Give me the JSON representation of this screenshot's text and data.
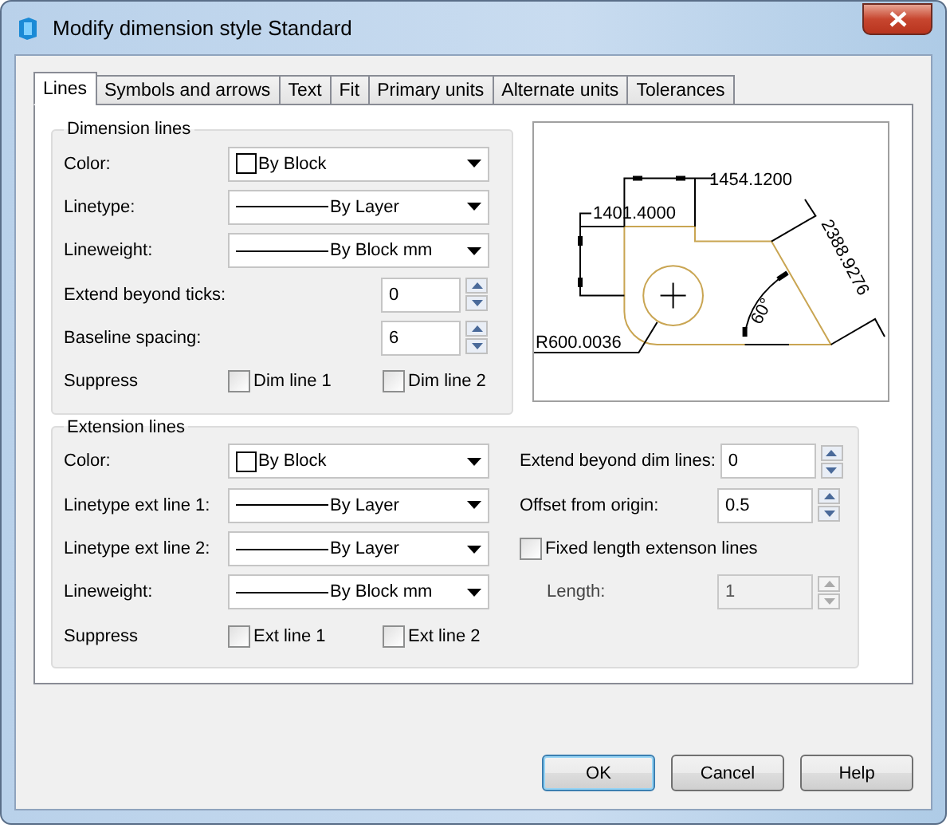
{
  "window": {
    "title": "Modify dimension style Standard"
  },
  "tabs": [
    {
      "label": "Lines",
      "selected": true
    },
    {
      "label": "Symbols and arrows",
      "selected": false
    },
    {
      "label": "Text",
      "selected": false
    },
    {
      "label": "Fit",
      "selected": false
    },
    {
      "label": "Primary units",
      "selected": false
    },
    {
      "label": "Alternate units",
      "selected": false
    },
    {
      "label": "Tolerances",
      "selected": false
    }
  ],
  "dimension_lines": {
    "title": "Dimension lines",
    "rows": [
      {
        "kind": "color",
        "label": "Color:",
        "value": "By Block"
      },
      {
        "kind": "linetype",
        "label": "Linetype:",
        "value": "By Layer"
      },
      {
        "kind": "linetype",
        "label": "Lineweight:",
        "value": "By Block mm"
      },
      {
        "kind": "spin",
        "label": "Extend beyond ticks:",
        "value": "0"
      },
      {
        "kind": "spin",
        "label": "Baseline spacing:",
        "value": "6"
      },
      {
        "kind": "checks",
        "label": "Suppress",
        "options": [
          {
            "label": "Dim line 1",
            "checked": false
          },
          {
            "label": "Dim line 2",
            "checked": false
          }
        ]
      }
    ]
  },
  "preview": {
    "labels": [
      "1454.1200",
      "1401.4000",
      "2388.9276",
      "60°",
      "R600.0036"
    ]
  },
  "extension_lines": {
    "title": "Extension lines",
    "rows": [
      {
        "kind": "color",
        "label": "Color:",
        "value": "By Block"
      },
      {
        "kind": "linetype",
        "label": "Linetype ext line 1:",
        "value": "By Layer"
      },
      {
        "kind": "linetype",
        "label": "Linetype ext line 2:",
        "value": "By Layer"
      },
      {
        "kind": "linetype",
        "label": "Lineweight:",
        "value": "By Block mm"
      },
      {
        "kind": "checks",
        "label": "Suppress",
        "options": [
          {
            "label": "Ext line 1",
            "checked": false
          },
          {
            "label": "Ext line 2",
            "checked": false
          }
        ]
      }
    ],
    "right_rows": [
      {
        "kind": "spin",
        "label": "Extend beyond dim lines:",
        "value": "0",
        "disabled": false
      },
      {
        "kind": "spin",
        "label": "Offset from origin:",
        "value": "0.5",
        "disabled": false
      },
      {
        "kind": "check",
        "label": "Fixed length extenson lines",
        "checked": false
      },
      {
        "kind": "spin",
        "label": "Length:",
        "value": "1",
        "disabled": true
      }
    ]
  },
  "buttons": [
    {
      "label": "OK",
      "default": true
    },
    {
      "label": "Cancel",
      "default": false
    },
    {
      "label": "Help",
      "default": false
    }
  ]
}
